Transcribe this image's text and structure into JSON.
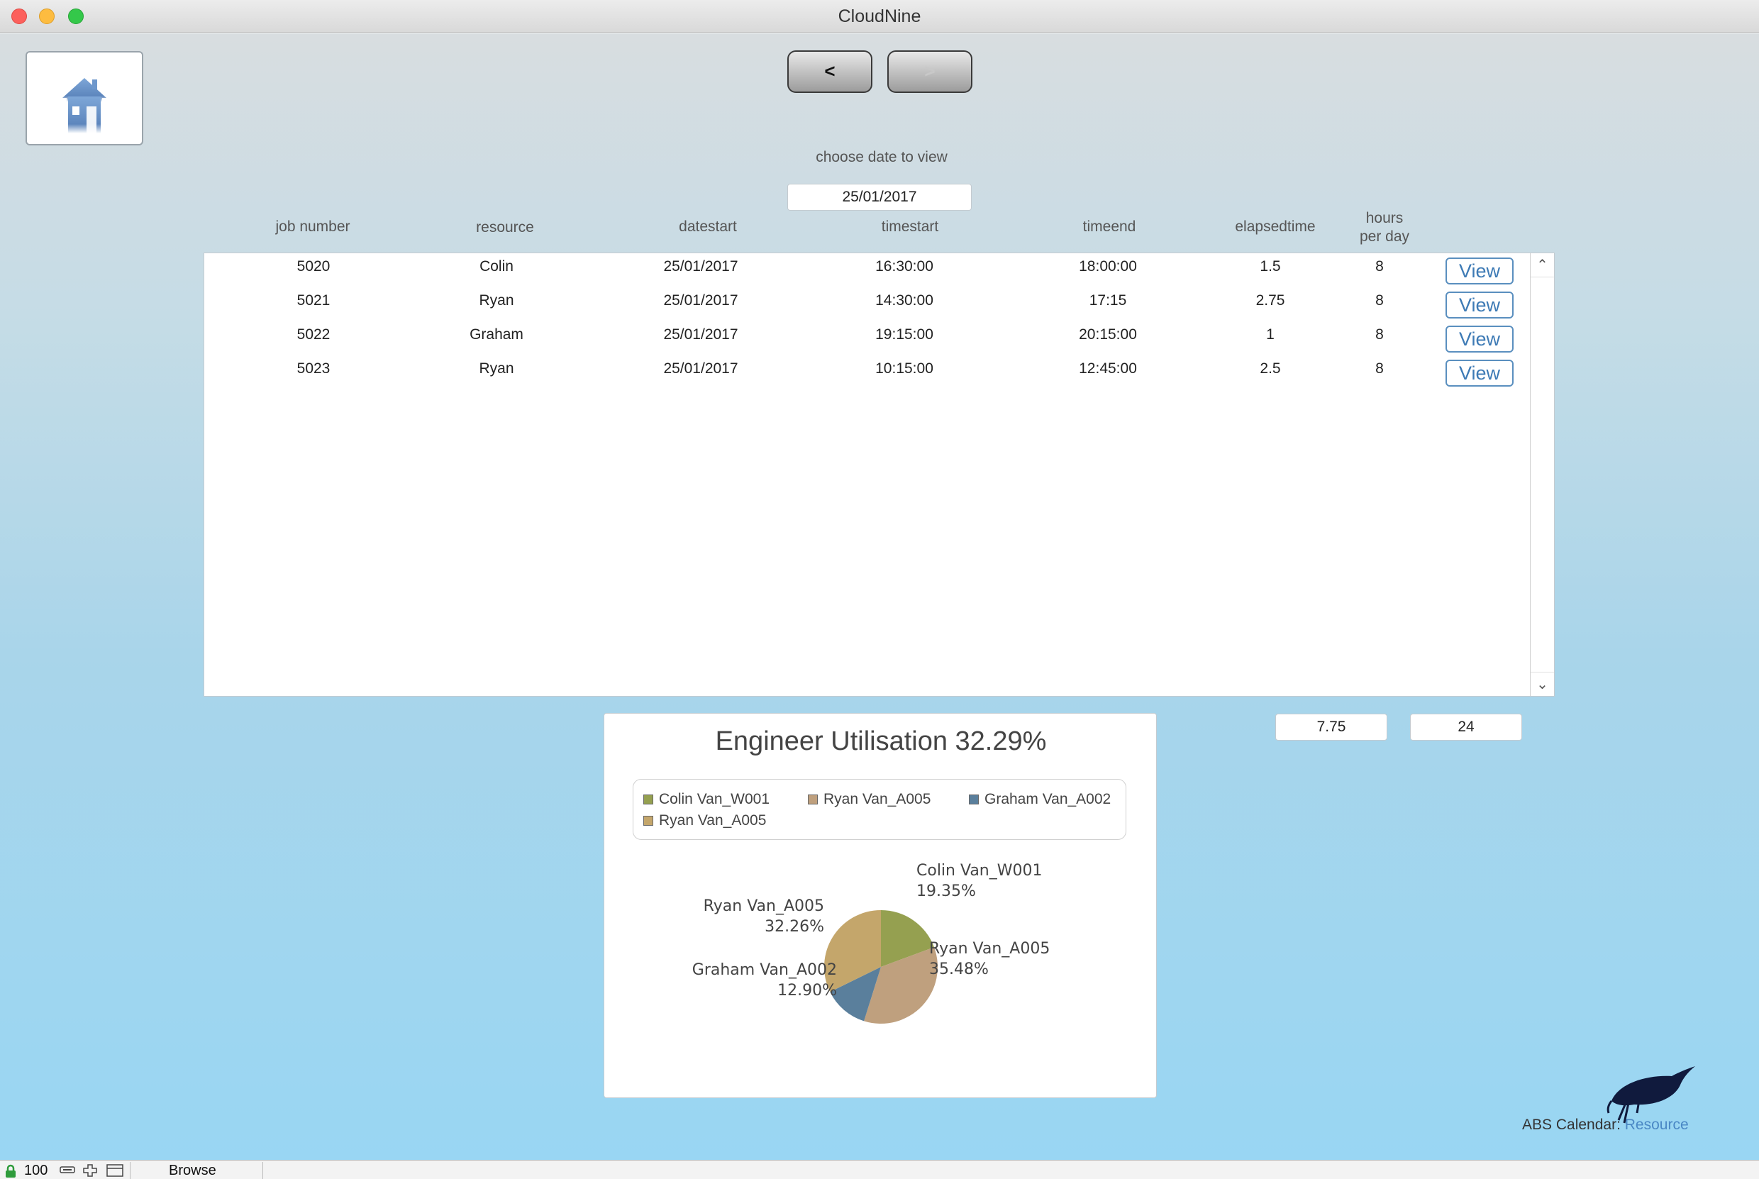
{
  "window": {
    "title": "CloudNine"
  },
  "nav": {
    "prev_label": "<",
    "next_label": ">"
  },
  "date_picker": {
    "label": "choose date to view",
    "value": "25/01/2017"
  },
  "table": {
    "columns": {
      "job_number": "job number",
      "resource": "resource",
      "datestart": "datestart",
      "timestart": "timestart",
      "timeend": "timeend",
      "elapsedtime": "elapsedtime",
      "hours_line1": "hours",
      "hours_line2": "per day"
    },
    "rows": [
      {
        "job": "5020",
        "resource": "Colin",
        "datestart": "25/01/2017",
        "timestart": "16:30:00",
        "timeend": "18:00:00",
        "elapsed": "1.5",
        "hours": "8",
        "view": "View"
      },
      {
        "job": "5021",
        "resource": "Ryan",
        "datestart": "25/01/2017",
        "timestart": "14:30:00",
        "timeend": "17:15",
        "elapsed": "2.75",
        "hours": "8",
        "view": "View"
      },
      {
        "job": "5022",
        "resource": "Graham",
        "datestart": "25/01/2017",
        "timestart": "19:15:00",
        "timeend": "20:15:00",
        "elapsed": "1",
        "hours": "8",
        "view": "View"
      },
      {
        "job": "5023",
        "resource": "Ryan",
        "datestart": "25/01/2017",
        "timestart": "10:15:00",
        "timeend": "12:45:00",
        "elapsed": "2.5",
        "hours": "8",
        "view": "View"
      }
    ]
  },
  "totals": {
    "elapsed_total": "7.75",
    "hours_total": "24"
  },
  "chart_data": {
    "type": "pie",
    "title": "Engineer Utilisation 32.29%",
    "legend": [
      "Colin Van_W001",
      "Ryan Van_A005",
      "Graham Van_A002",
      "Ryan Van_A005"
    ],
    "slices": [
      {
        "label": "Colin Van_W001",
        "pct_label": "19.35%",
        "value": 19.35,
        "color": "#95a050"
      },
      {
        "label": "Ryan Van_A005",
        "pct_label": "35.48%",
        "value": 35.48,
        "color": "#bfa07e"
      },
      {
        "label": "Graham Van_A002",
        "pct_label": "12.90%",
        "value": 12.9,
        "color": "#5a7f9c"
      },
      {
        "label": "Ryan Van_A005",
        "pct_label": "32.26%",
        "value": 32.26,
        "color": "#c4a66b"
      }
    ]
  },
  "footer": {
    "text": "ABS Calendar: ",
    "link": "Resource"
  },
  "statusbar": {
    "zoom": "100",
    "mode": "Browse"
  },
  "icons": {
    "home": "home-icon",
    "logo": "bird-logo-icon",
    "lock": "lock-icon"
  }
}
